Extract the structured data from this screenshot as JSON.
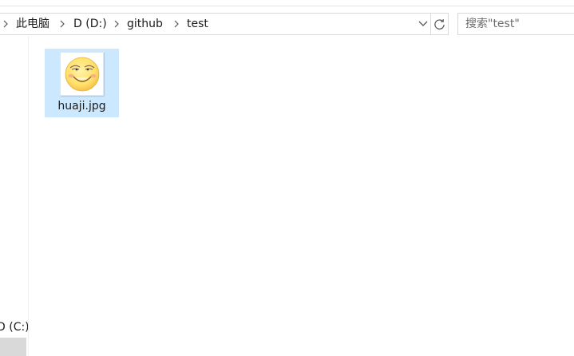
{
  "breadcrumb": {
    "items": [
      "此电脑",
      "D (D:)",
      "github",
      "test"
    ]
  },
  "search": {
    "placeholder": "搜索\"test\""
  },
  "nav": {
    "drive_label": "D (C:)"
  },
  "files": [
    {
      "name": "huaji.jpg",
      "icon": "huaji-thumbnail",
      "selected": true
    }
  ],
  "colors": {
    "selection": "#cce8ff",
    "border": "#d9d9d9",
    "text": "#1b1b1b"
  },
  "icons": {
    "breadcrumb_separator": "chevron-right-icon",
    "address_dropdown": "chevron-down-icon",
    "refresh": "refresh-icon"
  }
}
